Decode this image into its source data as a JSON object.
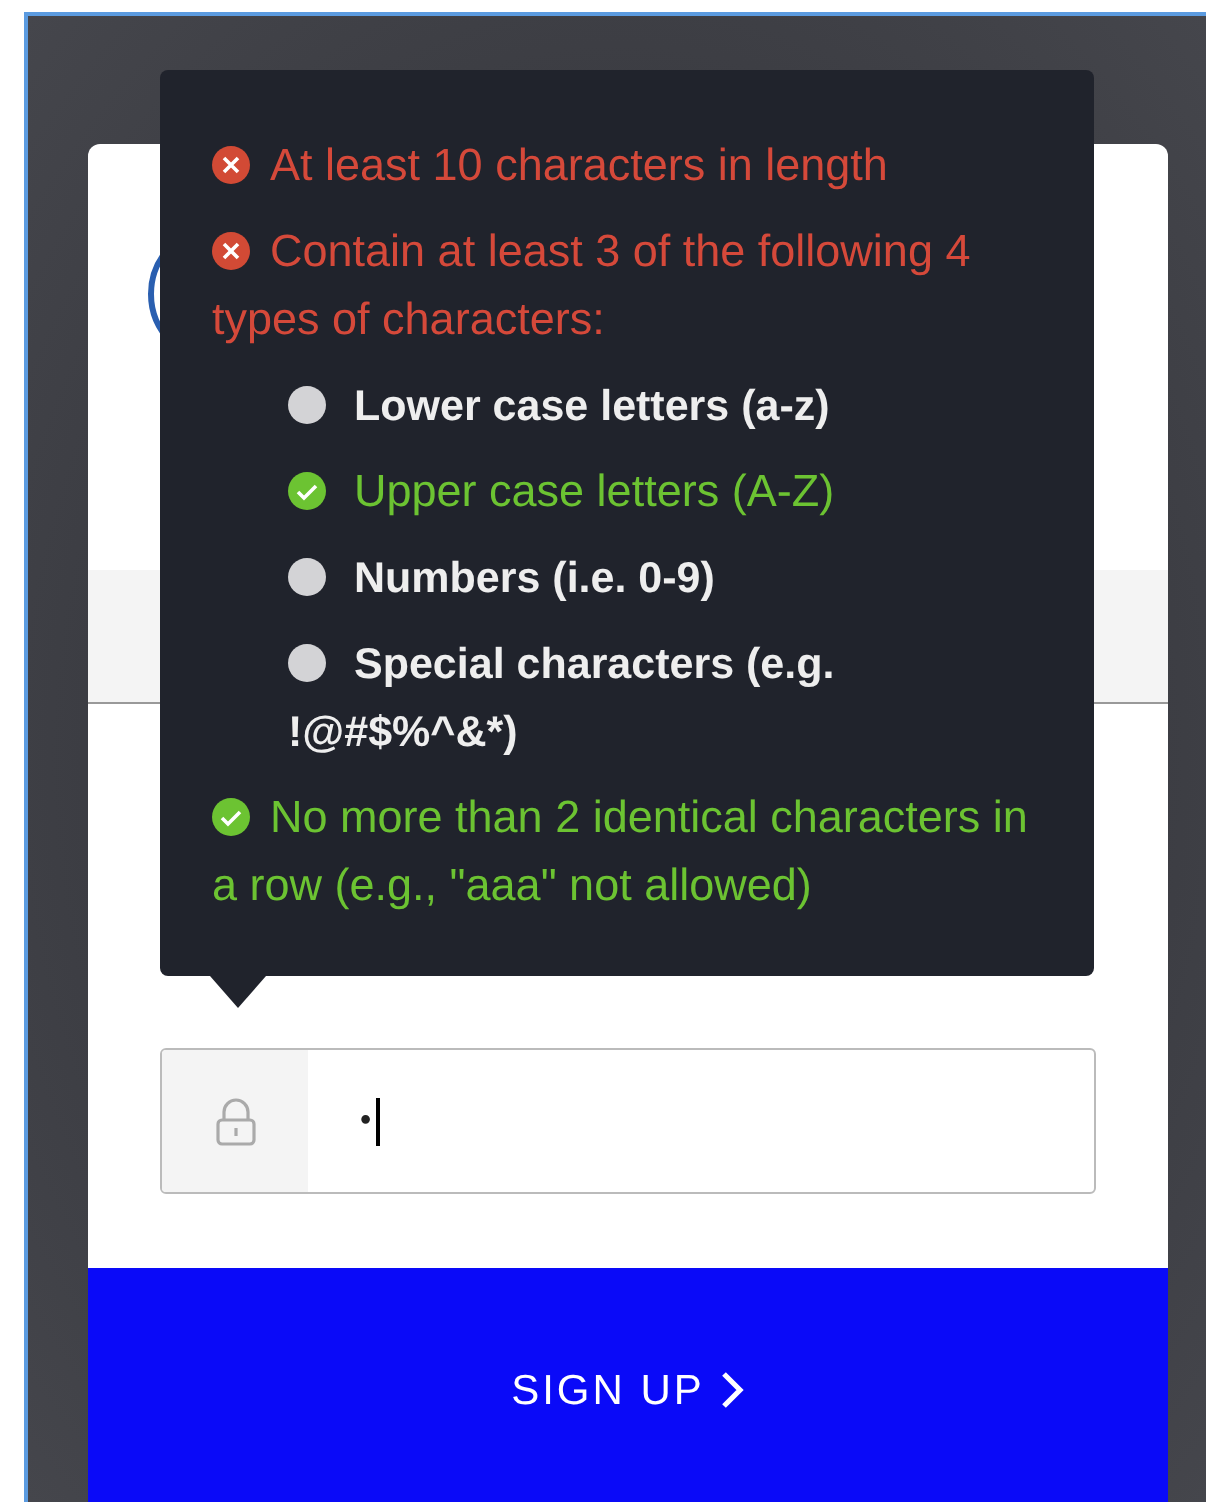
{
  "password_rules": [
    {
      "text": "At least 10 characters in length",
      "kind": "fail"
    },
    {
      "text": "Contain at least 3 of the following 4 types of characters:",
      "kind": "fail",
      "children": [
        {
          "text": "Lower case letters (a-z)",
          "kind": "pending"
        },
        {
          "text": "Upper case letters (A-Z)",
          "kind": "pass"
        },
        {
          "text": "Numbers (i.e. 0-9)",
          "kind": "pending"
        },
        {
          "text": "Special characters (e.g. !@#$%^&*)",
          "kind": "pending"
        }
      ]
    },
    {
      "text": "No more than 2 identical characters in a row (e.g., \"aaa\" not allowed)",
      "kind": "pass"
    }
  ],
  "password_field": {
    "value": "•"
  },
  "submit_button": {
    "label": "SIGN UP"
  }
}
